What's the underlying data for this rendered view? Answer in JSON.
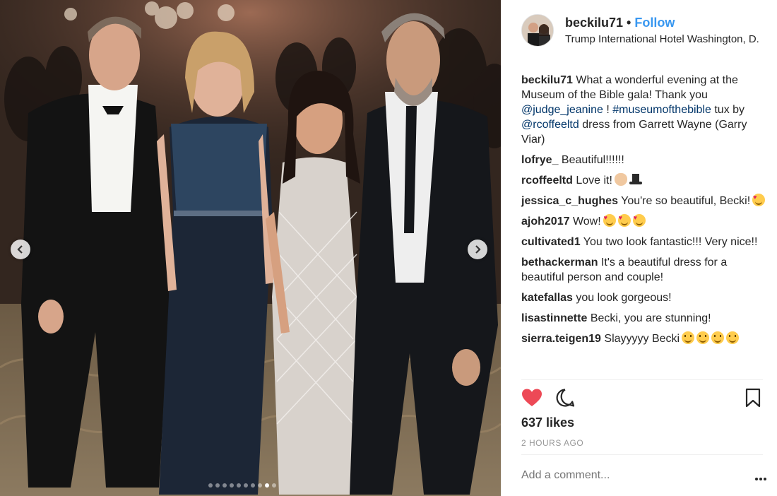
{
  "header": {
    "username": "beckilu71",
    "separator": "•",
    "follow_label": "Follow",
    "location": "Trump International Hotel Washington, D..."
  },
  "caption": {
    "author": "beckilu71",
    "text_1": "What a wonderful evening at the Museum of the Bible gala! Thank you",
    "mention_1": "@judge_jeanine",
    "text_2": "!",
    "mention_2": "#museumofthebible",
    "text_3": "tux by",
    "mention_3": "@rcoffeeltd",
    "text_4": "dress from Garrett Wayne (Garry Viar)"
  },
  "comments": [
    {
      "author": "lofrye_",
      "text": "Beautiful!!!!!!",
      "emoji": []
    },
    {
      "author": "rcoffeeltd",
      "text": "Love it!",
      "emoji": [
        "ok",
        "tophat"
      ]
    },
    {
      "author": "jessica_c_hughes",
      "text": "You're so beautiful, Becki!",
      "emoji": [
        "heart-eyes"
      ]
    },
    {
      "author": "ajoh2017",
      "text": "Wow!",
      "emoji": [
        "heart-eyes",
        "heart-eyes",
        "heart-eyes"
      ]
    },
    {
      "author": "cultivated1",
      "text": "You two look fantastic!!! Very nice!!",
      "emoji": []
    },
    {
      "author": "bethackerman",
      "text": "It's a beautiful dress for a beautiful person and couple!",
      "emoji": []
    },
    {
      "author": "katefallas",
      "text": "you look gorgeous!",
      "emoji": []
    },
    {
      "author": "lisastinnette",
      "text": "Becki, you are stunning!",
      "emoji": []
    },
    {
      "author": "sierra.teigen19",
      "text": "Slayyyyy Becki",
      "emoji": [
        "smile",
        "smile",
        "smile",
        "smile"
      ]
    }
  ],
  "engagement": {
    "likes": "637 likes",
    "timestamp": "2 HOURS AGO"
  },
  "composer": {
    "placeholder": "Add a comment..."
  },
  "carousel": {
    "total_slides": 10,
    "active_slide": 9
  },
  "icons": {
    "like": "heart-icon",
    "comment": "comment-bubble-icon",
    "save": "bookmark-icon",
    "more": "more-options-icon",
    "prev": "chevron-left-icon",
    "next": "chevron-right-icon"
  },
  "colors": {
    "link": "#3897f0",
    "mention": "#003569",
    "liked_heart": "#ed4956",
    "muted": "#999999"
  }
}
